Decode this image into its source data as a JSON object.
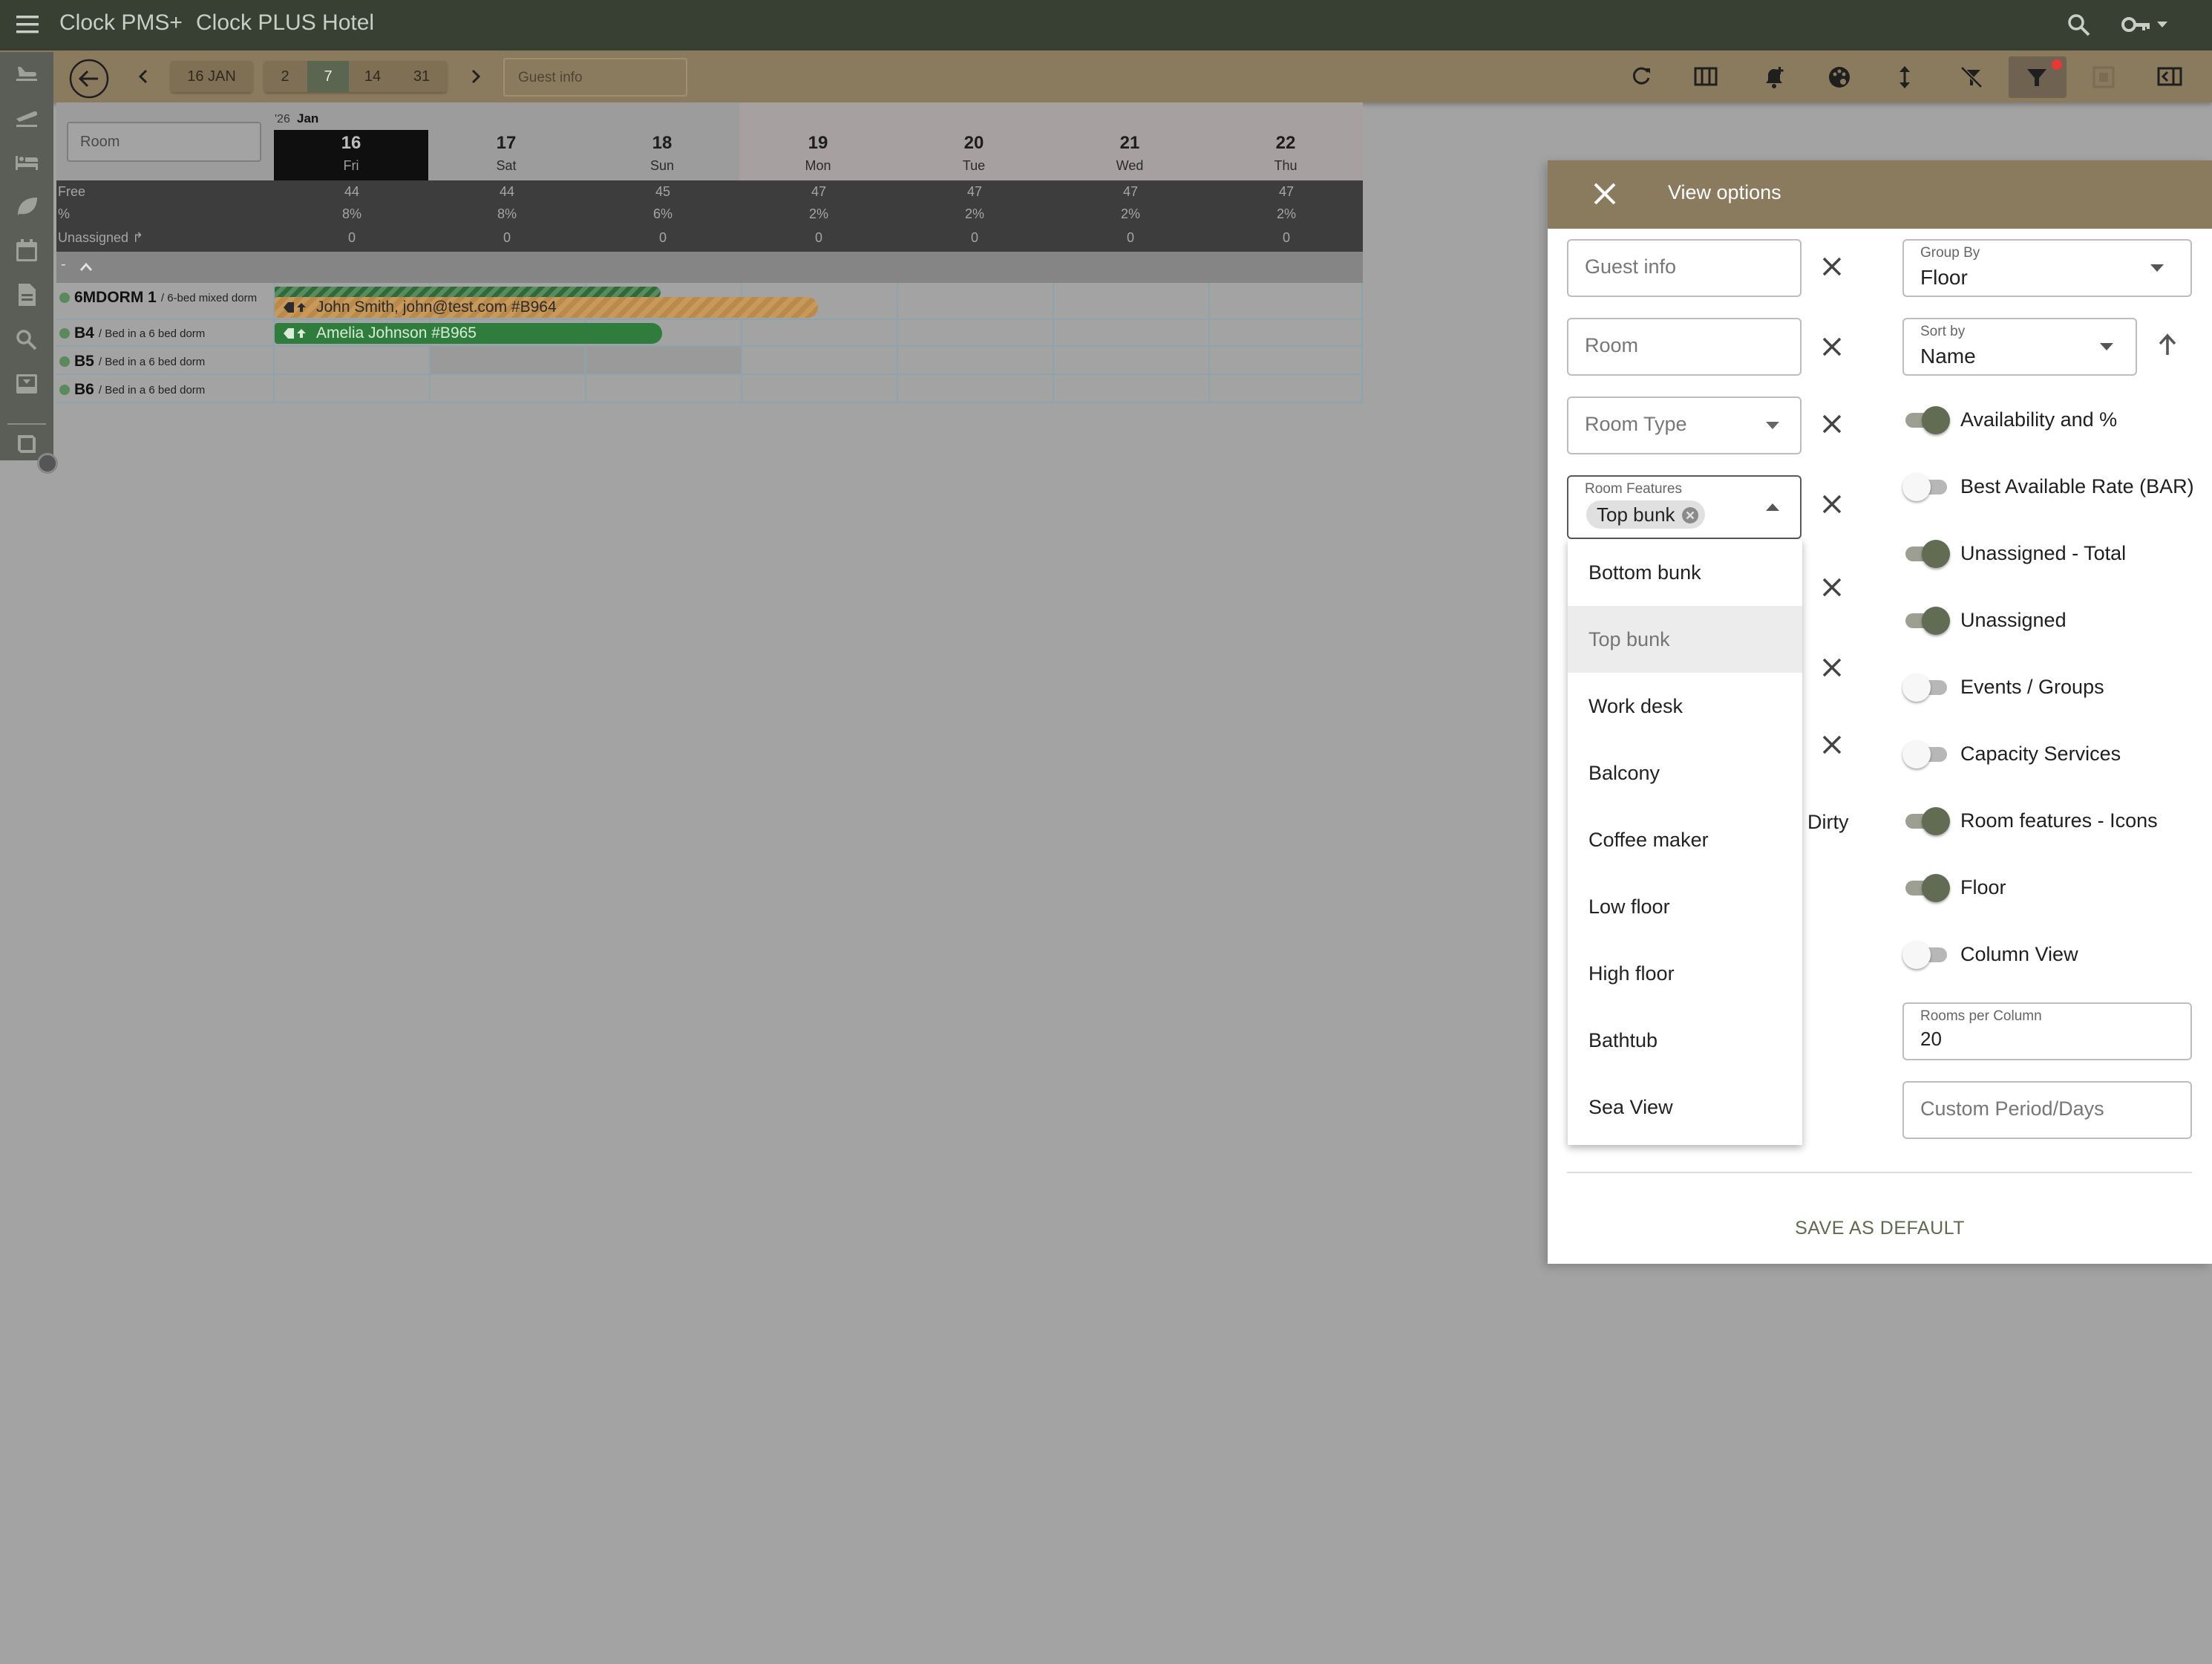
{
  "app": {
    "menu_icon": "menu-icon",
    "product": "Clock PMS+",
    "hotel": "Clock PLUS Hotel",
    "search_icon": "search-icon",
    "key_icon": "key-icon"
  },
  "toolbar": {
    "date_button": "16 JAN",
    "ranges": [
      "2",
      "7",
      "14",
      "31"
    ],
    "active_range": "7",
    "guest_info_placeholder": "Guest info"
  },
  "calendar": {
    "room_placeholder": "Room",
    "year_month": "'26",
    "month": "Jan",
    "days": [
      {
        "num": "16",
        "name": "Fri",
        "today": true
      },
      {
        "num": "17",
        "name": "Sat"
      },
      {
        "num": "18",
        "name": "Sun"
      },
      {
        "num": "19",
        "name": "Mon"
      },
      {
        "num": "20",
        "name": "Tue"
      },
      {
        "num": "21",
        "name": "Wed"
      },
      {
        "num": "22",
        "name": "Thu"
      }
    ],
    "stats": [
      {
        "label": "Free",
        "values": [
          "44",
          "44",
          "45",
          "47",
          "47",
          "47",
          "47"
        ]
      },
      {
        "label": "%",
        "values": [
          "8%",
          "8%",
          "6%",
          "2%",
          "2%",
          "2%",
          "2%"
        ]
      },
      {
        "label": "Unassigned ↱",
        "values": [
          "0",
          "0",
          "0",
          "0",
          "0",
          "0",
          "0"
        ]
      }
    ],
    "group_toggle": "-",
    "rooms": [
      {
        "name": "6MDORM 1",
        "type": "/ 6-bed mixed dorm"
      },
      {
        "name": "B4",
        "type": "/ Bed in a 6 bed dorm"
      },
      {
        "name": "B5",
        "type": "/ Bed in a 6 bed dorm"
      },
      {
        "name": "B6",
        "type": "/ Bed in a 6 bed dorm"
      }
    ],
    "bookings": [
      {
        "text": "John Smith, john@test.com #B964",
        "color": "#c79a5a"
      },
      {
        "text": "Amelia Johnson #B965",
        "color": "#2e7d3c"
      }
    ]
  },
  "view_options": {
    "title": "View options",
    "guest_info_placeholder": "Guest info",
    "room_placeholder": "Room",
    "room_type_placeholder": "Room Type",
    "room_features_label": "Room Features",
    "room_features_chip": "Top bunk",
    "dirty_label": "Dirty",
    "group_by_label": "Group By",
    "group_by_value": "Floor",
    "sort_by_label": "Sort by",
    "sort_by_value": "Name",
    "toggles": [
      {
        "label": "Availability and %",
        "on": true
      },
      {
        "label": "Best Available Rate (BAR)",
        "on": false
      },
      {
        "label": "Unassigned - Total",
        "on": true
      },
      {
        "label": "Unassigned",
        "on": true
      },
      {
        "label": "Events / Groups",
        "on": false
      },
      {
        "label": "Capacity Services",
        "on": false
      },
      {
        "label": "Room features - Icons",
        "on": true
      },
      {
        "label": "Floor",
        "on": true
      },
      {
        "label": "Column View",
        "on": false
      }
    ],
    "rooms_per_column_label": "Rooms per Column",
    "rooms_per_column_value": "20",
    "custom_period_placeholder": "Custom Period/Days",
    "save_default": "SAVE AS DEFAULT",
    "feature_options": [
      "Bottom bunk",
      "Top bunk",
      "Work desk",
      "Balcony",
      "Coffee maker",
      "Low floor",
      "High floor",
      "Bathtub",
      "Sea View"
    ],
    "selected_feature": "Top bunk"
  },
  "colors": {
    "topbar": "#374032",
    "toolbar": "#8b7b5e",
    "toggle_on": "#616c53",
    "save_text": "#5f6a4f"
  }
}
